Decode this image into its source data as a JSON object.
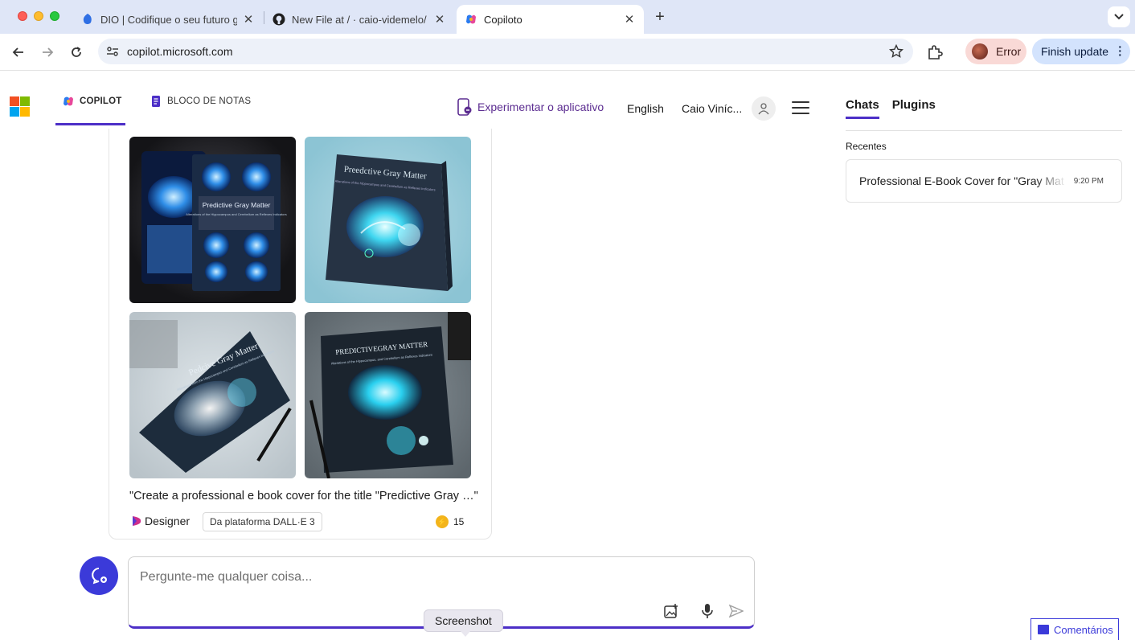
{
  "browser": {
    "tabs": [
      {
        "title": "DIO | Codifique o seu futuro g",
        "active": false
      },
      {
        "title": "New File at / · caio-videmelo/",
        "active": false
      },
      {
        "title": "Copiloto",
        "active": true
      }
    ],
    "url": "copilot.microsoft.com",
    "profile_label": "Error",
    "update_label": "Finish update"
  },
  "header": {
    "tabs": [
      {
        "label": "COPILOT",
        "active": true
      },
      {
        "label": "BLOCO DE NOTAS",
        "active": false
      }
    ],
    "try_app": "Experimentar o aplicativo",
    "language": "English",
    "user_name": "Caio Viníc..."
  },
  "sidebar": {
    "tabs": [
      {
        "label": "Chats",
        "active": true
      },
      {
        "label": "Plugins",
        "active": false
      }
    ],
    "recent_label": "Recentes",
    "recent_items": [
      {
        "title": "Professional E-Book Cover for \"Gray Mat",
        "time": "9:20 PM"
      }
    ]
  },
  "result": {
    "images": [
      {
        "cover_text": "Predictive Gray Matter",
        "subtitle": "Alterations of the Hippocampus and Cerebellum as Reflexes Indicators"
      },
      {
        "cover_text": "Preedctive Gray Matter",
        "subtitle": "Alterations of the Hippocampus and Cerebellum as Reflexes Indicators"
      },
      {
        "cover_text": "Pedcive Gray Matter",
        "subtitle": "Alterations from the Hippocampus and Cerebellum as Reflexes Indicators"
      },
      {
        "cover_text": "PREDICTIVEGRAY MATTER",
        "subtitle": "Alterations of the Hippocampus, and Cerebellum as Reflexes Indicators"
      }
    ],
    "caption": "\"Create a professional e book cover for the title \"Predictive Gray …\"",
    "designer_label": "Designer",
    "platform_badge": "Da plataforma DALL·E 3",
    "boost_count": "15"
  },
  "composer": {
    "placeholder": "Pergunte-me qualquer coisa...",
    "tooltip": "Screenshot"
  },
  "feedback_label": "Comentários",
  "colors": {
    "accent": "#4c2fc7",
    "new_topic": "#3b3ad9",
    "brand_purple": "#5c2d91"
  }
}
